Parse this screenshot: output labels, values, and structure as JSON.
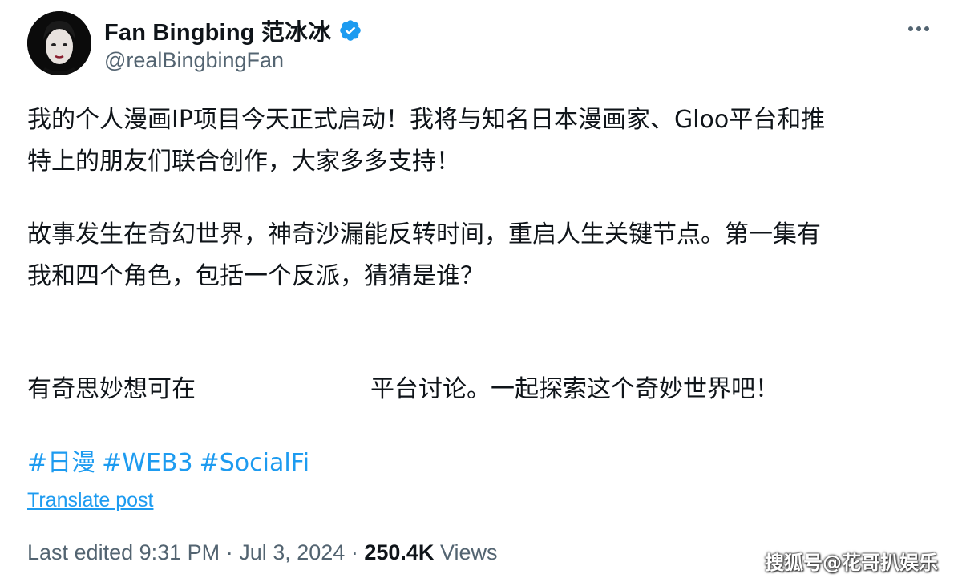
{
  "author": {
    "display_name": "Fan Bingbing 范冰冰",
    "handle": "@realBingbingFan",
    "verified": true
  },
  "post": {
    "paragraph1": [
      "我的个人漫画IP项目今天正式启动！我将与知名日本漫画家、Gloo平台和推",
      "特上的朋友们联合创作，大家多多支持！"
    ],
    "paragraph2": [
      "故事发生在奇幻世界，神奇沙漏能反转时间，重启人生关键节点。第一集有",
      "我和四个角色，包括一个反派，猜猜是谁？"
    ],
    "paragraph3_start": "有奇思妙想可在",
    "paragraph3_end": "平台讨论。一起探索这个奇妙世界吧！",
    "hashtags": [
      "#日漫",
      "#WEB3",
      "#SocialFi"
    ]
  },
  "translate_label": "Translate post",
  "meta": {
    "edited_prefix": "Last edited",
    "time": "9:31 PM",
    "separator": "·",
    "date": "Jul 3, 2024",
    "views_count": "250.4K",
    "views_label": "Views"
  },
  "watermark": "搜狐号@花哥扒娱乐",
  "icons": {
    "verified": "verified-badge-icon",
    "more": "more-options-icon"
  },
  "colors": {
    "link": "#1d9bf0",
    "secondary_text": "#536471",
    "primary_text": "#0f1419"
  }
}
